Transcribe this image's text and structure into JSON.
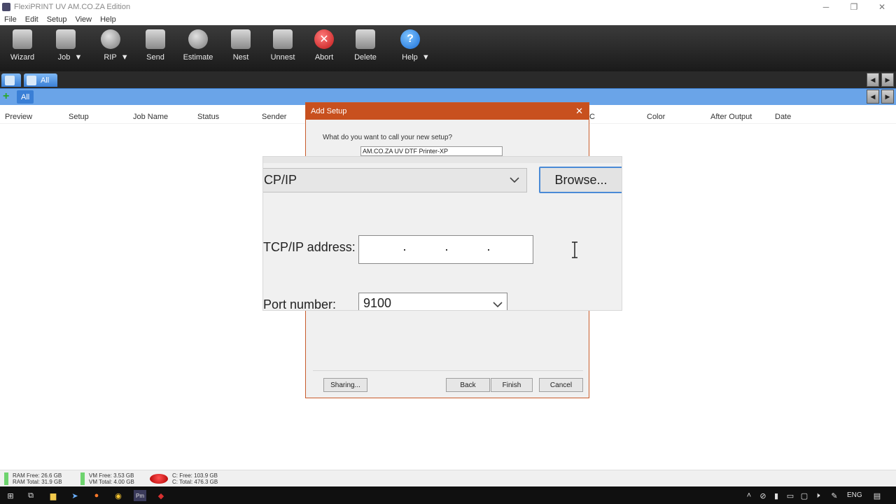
{
  "window": {
    "title": "FlexiPRINT UV AM.CO.ZA Edition"
  },
  "menu": [
    "File",
    "Edit",
    "Setup",
    "View",
    "Help"
  ],
  "toolbar": {
    "wizard": "Wizard",
    "job": "Job",
    "rip": "RIP",
    "send": "Send",
    "estimate": "Estimate",
    "nest": "Nest",
    "unnest": "Unnest",
    "abort": "Abort",
    "delete": "Delete",
    "help": "Help",
    "dropdown_glyph": "▼"
  },
  "tabs": {
    "row1_tab": "All",
    "row2_tab": "All"
  },
  "columns": [
    "Preview",
    "Setup",
    "Job Name",
    "Status",
    "Sender",
    "C",
    "Color",
    "After Output",
    "Date"
  ],
  "dialog": {
    "title": "Add Setup",
    "question": "What do you want to call your new setup?",
    "setup_name": "AM.CO.ZA UV DTF Printer-XP",
    "buttons": {
      "sharing": "Sharing...",
      "back": "Back",
      "finish": "Finish",
      "cancel": "Cancel"
    }
  },
  "zoom": {
    "connection": "CP/IP",
    "browse": "Browse...",
    "tcpip_label": "TCP/IP address:",
    "port_label": "Port number:",
    "port_value": "9100"
  },
  "status": {
    "ram_free": "RAM Free: 26.6 GB",
    "ram_total": "RAM Total: 31.9 GB",
    "vm_free": "VM Free: 3.53 GB",
    "vm_total": "VM Total: 4.00 GB",
    "c_free": "C: Free: 103.9 GB",
    "c_total": "C: Total: 476.3 GB"
  },
  "taskbar": {
    "lang": "ENG",
    "pinned_label": "Pm"
  },
  "colors": {
    "dialog_title": "#c8501e",
    "toolbar_dark": "#1a1a1a",
    "tab_blue": "#6aa4e8",
    "focus_blue": "#4a8ad6"
  }
}
